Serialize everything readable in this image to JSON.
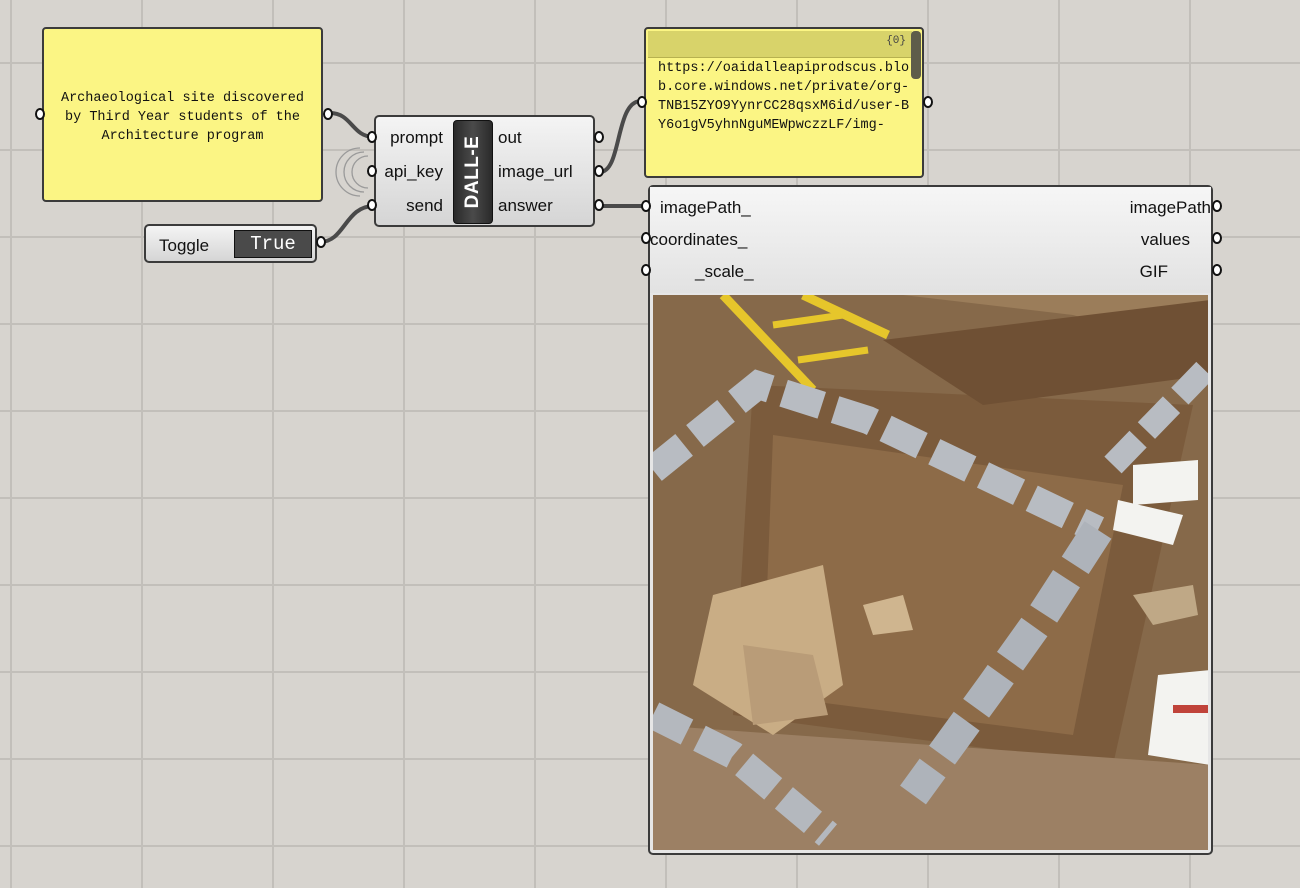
{
  "prompt_panel": {
    "text": "Archaeological site discovered by Third Year students of the Architecture program"
  },
  "dalle": {
    "name": "DALL-E",
    "inputs": [
      "prompt",
      "api_key",
      "send"
    ],
    "outputs": [
      "out",
      "image_url",
      "answer"
    ]
  },
  "toggle": {
    "label": "Toggle",
    "value": "True"
  },
  "url_panel": {
    "index": "{0}",
    "text": "https://oaidalleapiprodscus.blob.core.windows.net/private/org-TNB15ZYO9YynrCC28qsxM6id/user-BY6o1gV5yhnNguMEWpwczzLF/img-"
  },
  "viewer": {
    "inputs": [
      "imagePath_",
      "coordinates_",
      "_scale_"
    ],
    "outputs": [
      "imagePath",
      "values",
      "GIF"
    ]
  },
  "colors": {
    "canvas": "#d7d4cf",
    "panel": "#fbf584",
    "wire": "#4a4a4a"
  }
}
